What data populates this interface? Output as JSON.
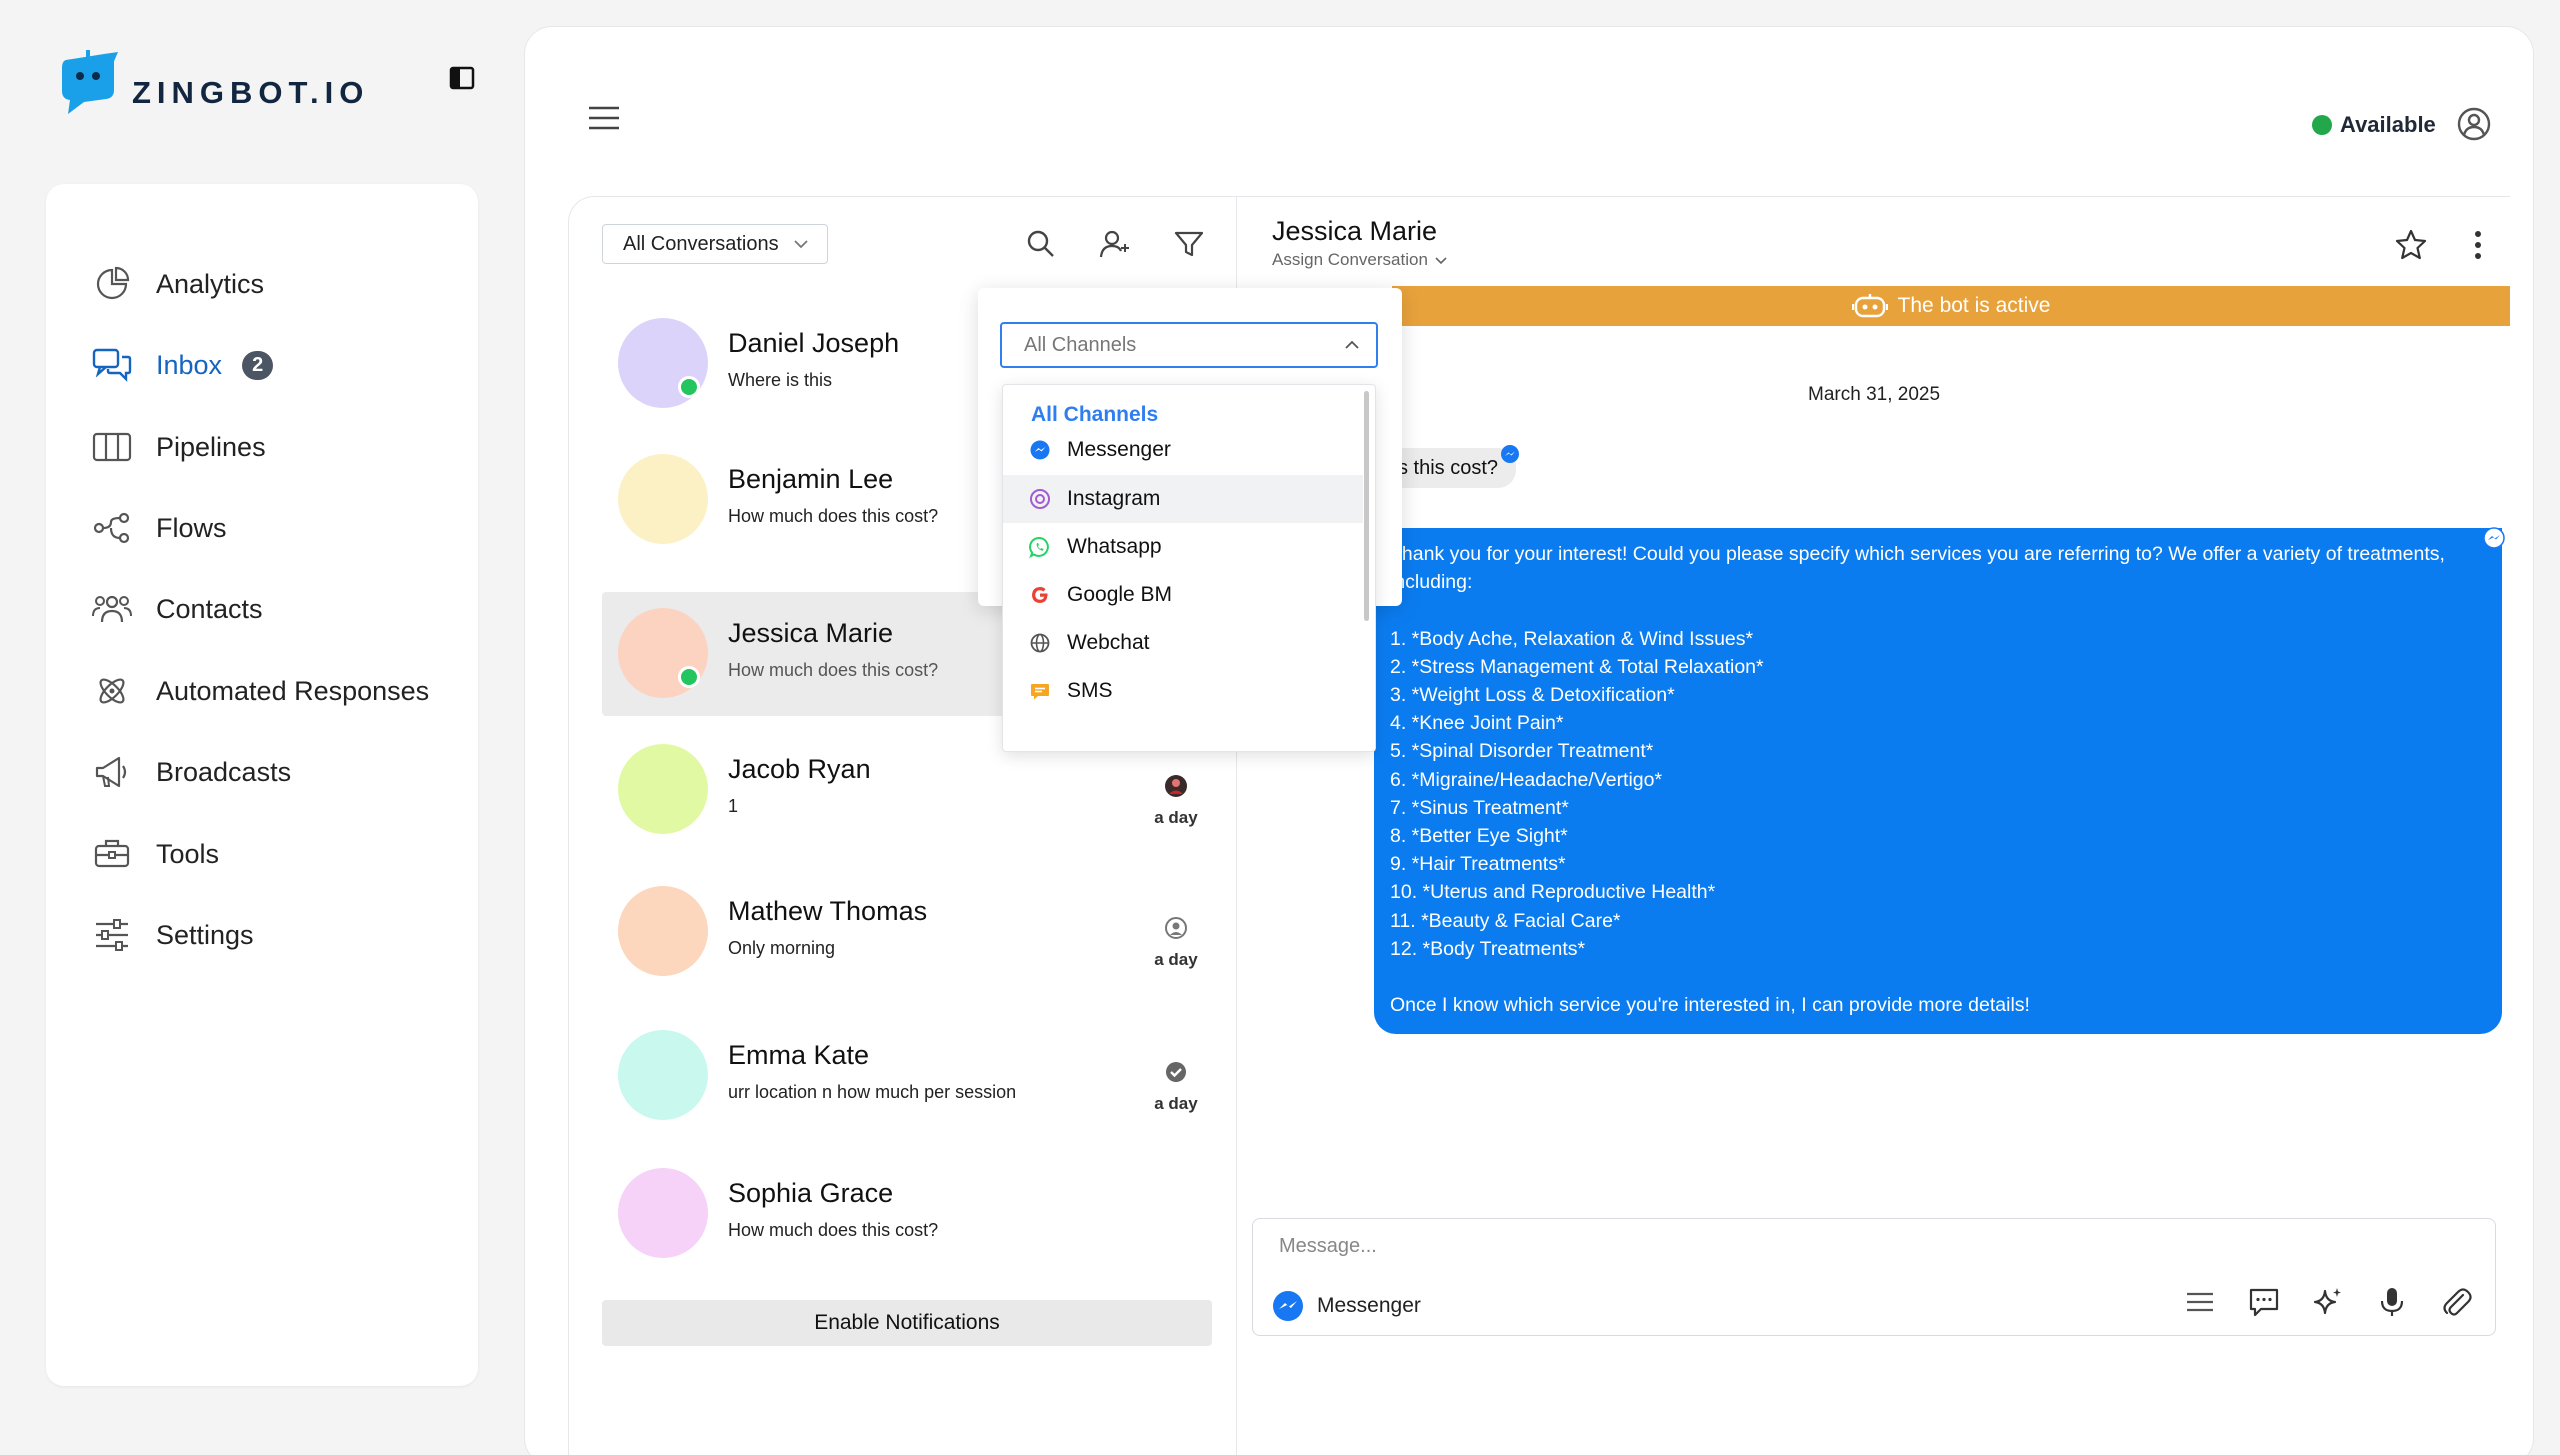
{
  "brand": {
    "name": "ZINGBOT.IO"
  },
  "sidebar": {
    "items": [
      {
        "label": "Analytics",
        "icon": "pie-chart-icon"
      },
      {
        "label": "Inbox",
        "icon": "chat-bubbles-icon",
        "badge": "2",
        "active": true
      },
      {
        "label": "Pipelines",
        "icon": "columns-icon"
      },
      {
        "label": "Flows",
        "icon": "flow-nodes-icon"
      },
      {
        "label": "Contacts",
        "icon": "people-icon"
      },
      {
        "label": "Automated Responses",
        "icon": "atom-icon"
      },
      {
        "label": "Broadcasts",
        "icon": "megaphone-icon"
      },
      {
        "label": "Tools",
        "icon": "toolbox-icon"
      },
      {
        "label": "Settings",
        "icon": "sliders-icon"
      }
    ]
  },
  "header": {
    "status": "Available",
    "status_color": "#22a84b"
  },
  "conversations": {
    "filter": "All Conversations",
    "items": [
      {
        "name": "Daniel Joseph",
        "message": "Where is this",
        "avatar_color": "#dcd3fb",
        "online": true
      },
      {
        "name": "Benjamin Lee",
        "message": "How much does this cost?",
        "avatar_color": "#fcf1c5",
        "online": false
      },
      {
        "name": "Jessica Marie",
        "message": "How much does this cost?",
        "avatar_color": "#fcd2c0",
        "online": true,
        "selected": true
      },
      {
        "name": "Jacob Ryan",
        "message": "1",
        "avatar_color": "#e2f9a4",
        "online": false,
        "time": "a day"
      },
      {
        "name": "Mathew Thomas",
        "message": "Only morning",
        "avatar_color": "#fcd7bd",
        "online": false,
        "time": "a day"
      },
      {
        "name": "Emma Kate",
        "message": "urr location n how much per session",
        "avatar_color": "#c8f8ee",
        "online": false,
        "time": "a day"
      },
      {
        "name": "Sophia Grace",
        "message": "How much does this cost?",
        "avatar_color": "#f6d2f8",
        "online": false
      }
    ],
    "enable_notifications": "Enable Notifications"
  },
  "channel_filter": {
    "selected": "All Channels",
    "options": [
      {
        "label": "Messenger",
        "icon": "messenger-icon",
        "color": "#1877f2"
      },
      {
        "label": "Instagram",
        "icon": "instagram-icon",
        "color": "#a35bd1"
      },
      {
        "label": "Whatsapp",
        "icon": "whatsapp-icon",
        "color": "#25d366"
      },
      {
        "label": "Google BM",
        "icon": "google-icon",
        "color": "#ea4335"
      },
      {
        "label": "Webchat",
        "icon": "globe-icon",
        "color": "#555555"
      },
      {
        "label": "SMS",
        "icon": "sms-icon",
        "color": "#f5a623"
      }
    ]
  },
  "chat": {
    "contact_name": "Jessica Marie",
    "assign_label": "Assign Conversation",
    "bot_banner": "The bot is active",
    "bot_banner_color": "#e8a23c",
    "date": "March 31, 2025",
    "incoming_message": "s this cost?",
    "outgoing_message": "Thank you for your interest! Could you please specify which services you are referring to? We offer a variety of treatments, including:\n\n1. *Body Ache, Relaxation & Wind Issues*\n2. *Stress Management & Total Relaxation*\n3. *Weight Loss & Detoxification*\n4. *Knee Joint Pain*\n5. *Spinal Disorder Treatment*\n6. *Migraine/Headache/Vertigo*\n7. *Sinus Treatment*\n8. *Better Eye Sight*\n9. *Hair Treatments*\n10. *Uterus and Reproductive Health*\n11. *Beauty & Facial Care*\n12. *Body Treatments*\n\nOnce I know which service you're interested in, I can provide more details!",
    "outgoing_color": "#0b7cf0"
  },
  "composer": {
    "placeholder": "Message...",
    "channel": "Messenger"
  }
}
